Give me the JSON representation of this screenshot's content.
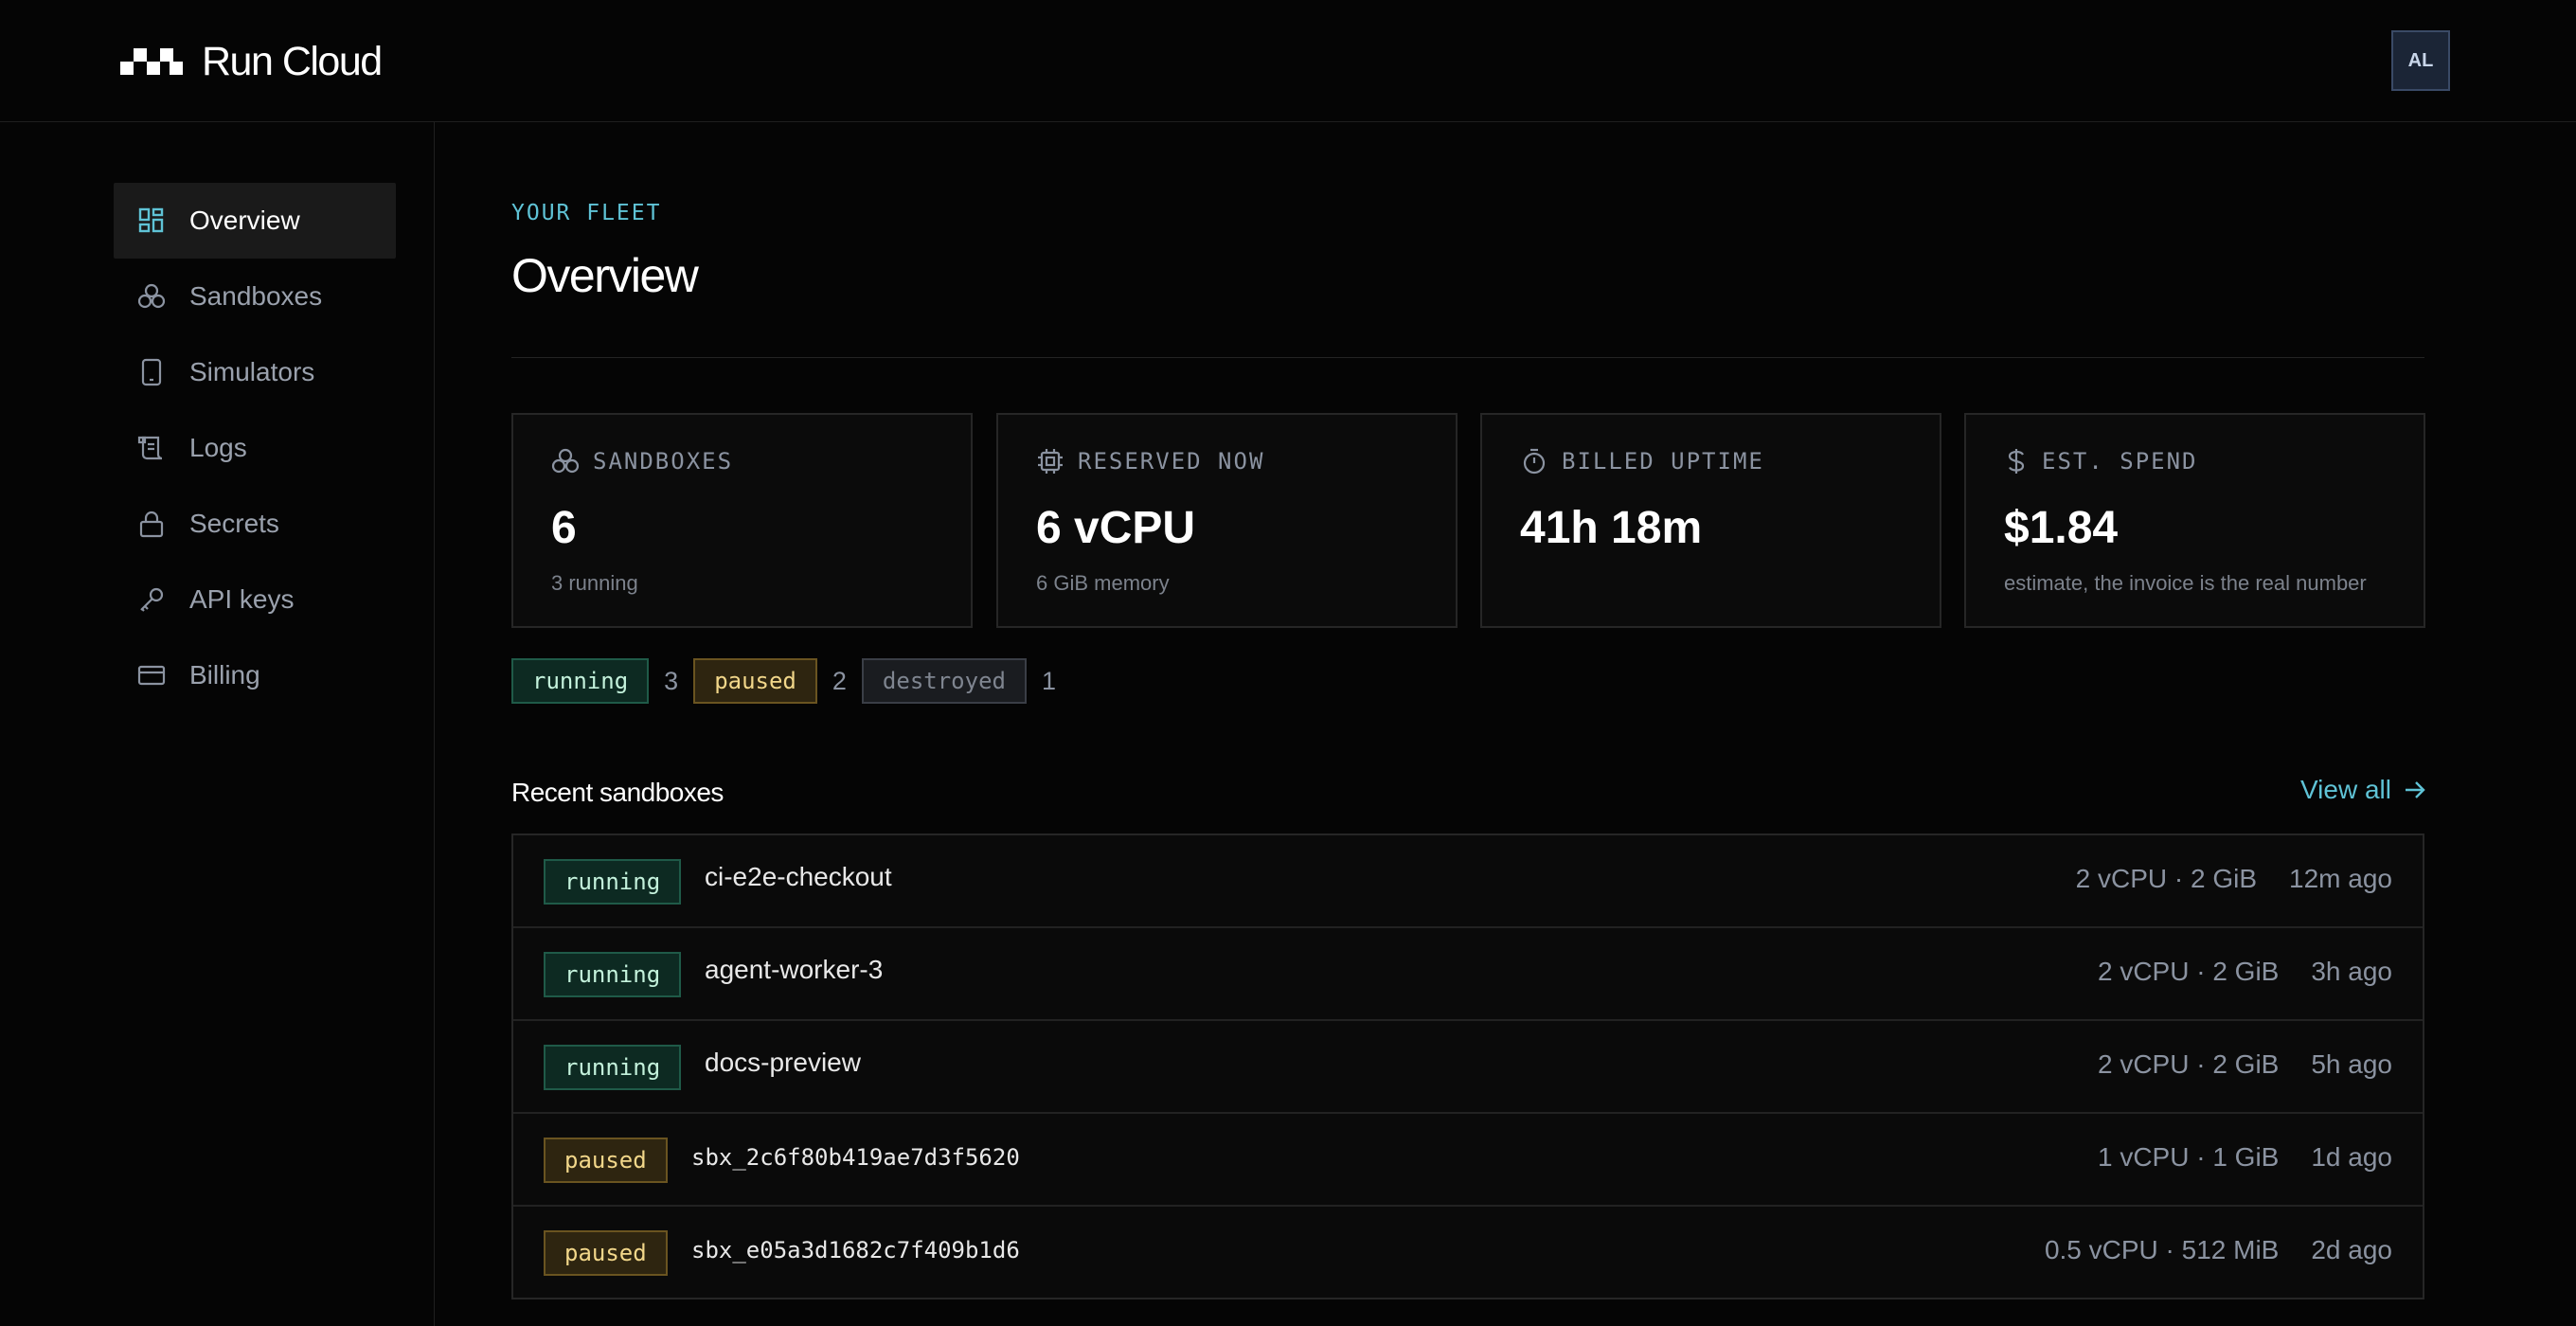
{
  "header": {
    "brand_name": "Run Cloud",
    "avatar_initials": "AL"
  },
  "sidebar": {
    "items": [
      {
        "label": "Overview",
        "icon": "grid-icon",
        "active": true
      },
      {
        "label": "Sandboxes",
        "icon": "cubes-icon",
        "active": false
      },
      {
        "label": "Simulators",
        "icon": "phone-icon",
        "active": false
      },
      {
        "label": "Logs",
        "icon": "scroll-icon",
        "active": false
      },
      {
        "label": "Secrets",
        "icon": "lock-icon",
        "active": false
      },
      {
        "label": "API keys",
        "icon": "key-icon",
        "active": false
      },
      {
        "label": "Billing",
        "icon": "credit-card-icon",
        "active": false
      }
    ]
  },
  "page": {
    "eyebrow": "YOUR FLEET",
    "title": "Overview"
  },
  "cards": [
    {
      "label": "SANDBOXES",
      "icon": "cubes-icon",
      "value": "6",
      "sub": "3 running"
    },
    {
      "label": "RESERVED NOW",
      "icon": "cpu-icon",
      "value": "6 vCPU",
      "sub": "6 GiB memory"
    },
    {
      "label": "BILLED UPTIME",
      "icon": "stopwatch-icon",
      "value": "41h 18m",
      "sub": ""
    },
    {
      "label": "EST. SPEND",
      "icon": "dollar-icon",
      "value": "$1.84",
      "sub": "estimate, the invoice is the real number"
    }
  ],
  "status_summary": [
    {
      "status": "running",
      "count": "3"
    },
    {
      "status": "paused",
      "count": "2"
    },
    {
      "status": "destroyed",
      "count": "1"
    }
  ],
  "recent": {
    "title": "Recent sandboxes",
    "view_all": "View all",
    "rows": [
      {
        "status": "running",
        "name": "ci-e2e-checkout",
        "mono": false,
        "spec": "2 vCPU · 2 GiB",
        "age": "12m ago"
      },
      {
        "status": "running",
        "name": "agent-worker-3",
        "mono": false,
        "spec": "2 vCPU · 2 GiB",
        "age": "3h ago"
      },
      {
        "status": "running",
        "name": "docs-preview",
        "mono": false,
        "spec": "2 vCPU · 2 GiB",
        "age": "5h ago"
      },
      {
        "status": "paused",
        "name": "sbx_2c6f80b419ae7d3f5620",
        "mono": true,
        "spec": "1 vCPU · 1 GiB",
        "age": "1d ago"
      },
      {
        "status": "paused",
        "name": "sbx_e05a3d1682c7f409b1d6",
        "mono": true,
        "spec": "0.5 vCPU · 512 MiB",
        "age": "2d ago"
      }
    ]
  },
  "colors": {
    "accent": "#5fc3d6",
    "running": "#c4f2dc",
    "paused": "#f2d78a",
    "destroyed": "#7f8590"
  }
}
